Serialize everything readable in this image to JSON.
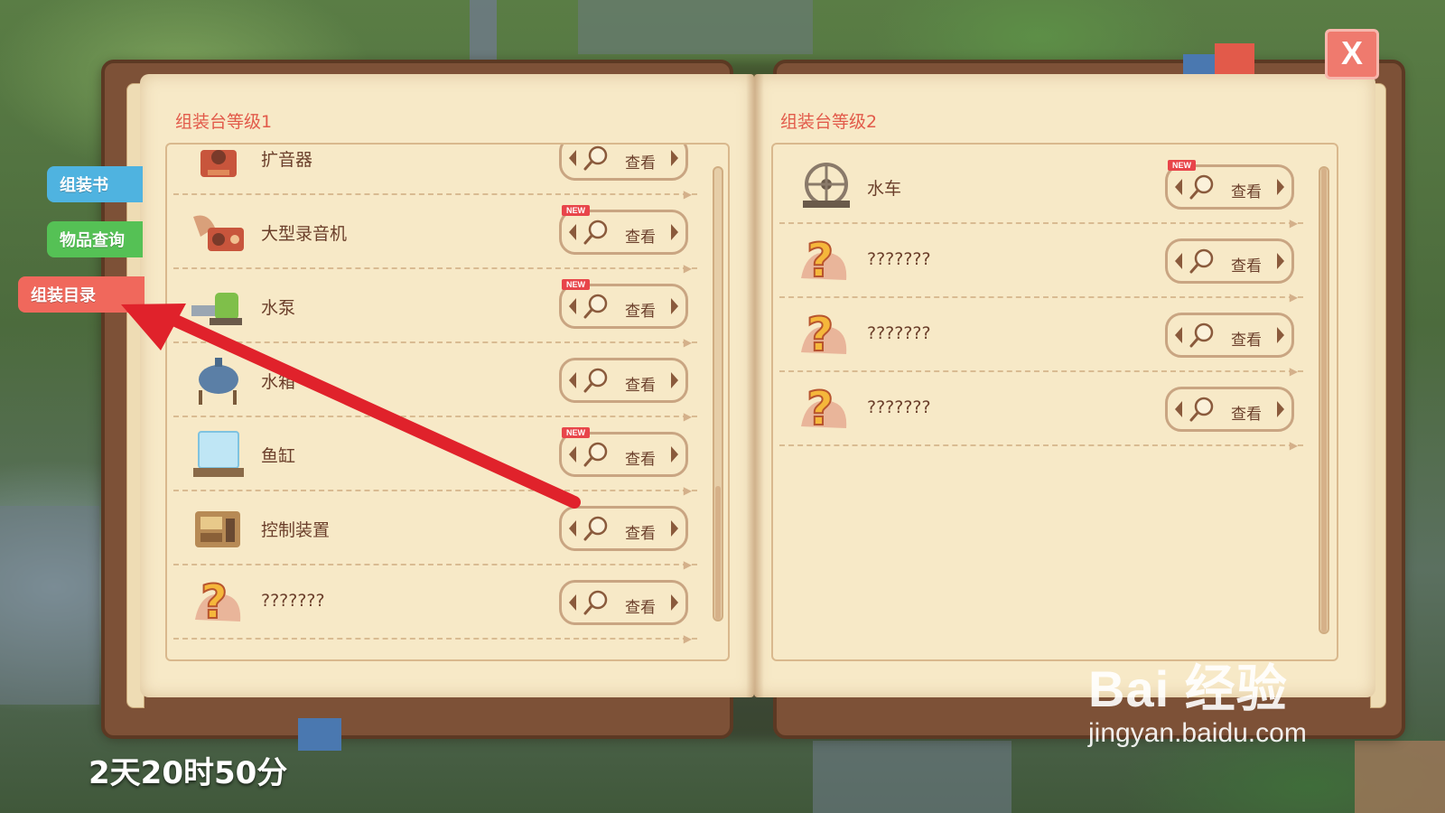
{
  "side_tabs": [
    {
      "label": "组装书",
      "color": "#4fb3e0"
    },
    {
      "label": "物品查询",
      "color": "#55c155"
    },
    {
      "label": "组装目录",
      "color": "#f0685c"
    }
  ],
  "close_label": "X",
  "left_page": {
    "title": "组装台等级1",
    "items": [
      {
        "name": "扩音器",
        "icon": "amplifier-icon",
        "is_new": false
      },
      {
        "name": "大型录音机",
        "icon": "recorder-icon",
        "is_new": true
      },
      {
        "name": "水泵",
        "icon": "water-pump-icon",
        "is_new": true
      },
      {
        "name": "水箱",
        "icon": "water-tank-icon",
        "is_new": false
      },
      {
        "name": "鱼缸",
        "icon": "fish-tank-icon",
        "is_new": true
      },
      {
        "name": "控制装置",
        "icon": "control-device-icon",
        "is_new": false
      },
      {
        "name": "???????",
        "icon": "unknown-icon",
        "is_new": false
      }
    ]
  },
  "right_page": {
    "title": "组装台等级2",
    "items": [
      {
        "name": "水车",
        "icon": "waterwheel-icon",
        "is_new": true
      },
      {
        "name": "???????",
        "icon": "unknown-icon",
        "is_new": false
      },
      {
        "name": "???????",
        "icon": "unknown-icon",
        "is_new": false
      },
      {
        "name": "???????",
        "icon": "unknown-icon",
        "is_new": false
      }
    ]
  },
  "view_button_label": "查看",
  "new_badge_label": "NEW",
  "timer": "2天20时50分",
  "watermark": {
    "brand": "Bai 经验",
    "url": "jingyan.baidu.com"
  },
  "colors": {
    "title_red": "#e25a4a",
    "parchment": "#f7e9c7",
    "cover_brown": "#7d5137",
    "arrow_red": "#e0222b"
  }
}
